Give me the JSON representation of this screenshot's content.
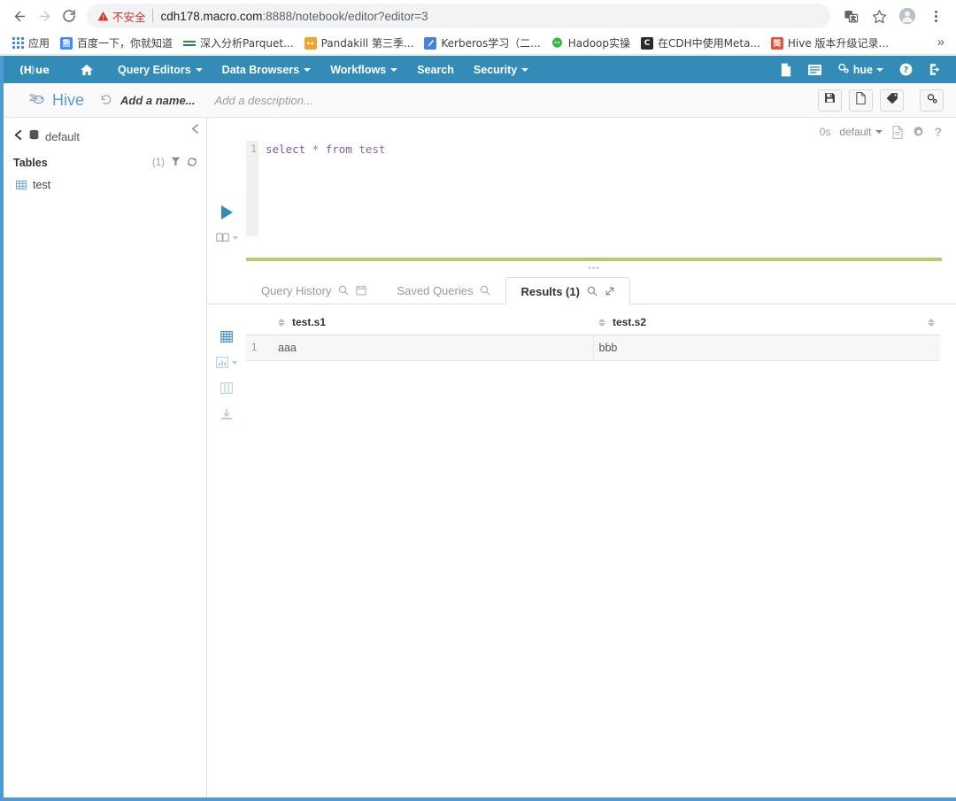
{
  "browser": {
    "back_icon": "back-arrow-icon",
    "forward_icon": "forward-arrow-icon",
    "reload_icon": "reload-icon",
    "security_warning": "不安全",
    "url_host": "cdh178.macro.com",
    "url_rest": ":8888/notebook/editor?editor=3",
    "url_full": "cdh178.macro.com:8888/notebook/editor?editor=3",
    "translate_icon": "translate-icon",
    "bookmark_icon": "star-icon",
    "profile_icon": "profile-avatar-icon",
    "menu_icon": "kebab-menu-icon",
    "bookmarks": [
      {
        "label": "应用",
        "favicon": "apps-grid-icon",
        "color": "#4285f4"
      },
      {
        "label": "百度一下，你就知道",
        "favicon": "baidu-icon",
        "color": "#3b8cff"
      },
      {
        "label": "深入分析Parquet...",
        "favicon": "article-icon",
        "color": "#4c8c3f"
      },
      {
        "label": "Pandakill 第三季...",
        "favicon": "panda-icon",
        "color": "#f0a32e"
      },
      {
        "label": "Kerberos学习（二...",
        "favicon": "pencil-icon",
        "color": "#4a7fe0"
      },
      {
        "label": "Hadoop实操",
        "favicon": "chat-icon",
        "color": "#3ab84a"
      },
      {
        "label": "在CDH中使用Meta...",
        "favicon": "letter-c-icon",
        "color": "#2b2b2b"
      },
      {
        "label": "Hive 版本升级记录...",
        "favicon": "jian-icon",
        "color": "#e8503a"
      }
    ],
    "bookmarks_overflow": "»"
  },
  "hue": {
    "brand": "Hue",
    "home_icon": "home-icon",
    "nav_items": [
      {
        "label": "Query Editors",
        "has_caret": true
      },
      {
        "label": "Data Browsers",
        "has_caret": true
      },
      {
        "label": "Workflows",
        "has_caret": true
      },
      {
        "label": "Search",
        "has_caret": false
      },
      {
        "label": "Security",
        "has_caret": true
      }
    ],
    "nav_right": {
      "documents_icon": "document-icon",
      "jobs_icon": "list-icon",
      "user_label": "hue",
      "user_icon": "gears-icon",
      "help_icon": "help-circle-icon",
      "logout_icon": "logout-icon"
    },
    "navbar_color": "#338bb8"
  },
  "hive_header": {
    "app_icon": "hive-bee-icon",
    "title": "Hive",
    "revert_icon": "revert-history-icon",
    "name_placeholder": "Add a name...",
    "description_placeholder": "Add a description...",
    "actions": [
      {
        "name": "save-button",
        "icon": "floppy-save-icon"
      },
      {
        "name": "new-query-button",
        "icon": "new-document-icon"
      },
      {
        "name": "tag-button",
        "icon": "tag-icon"
      },
      {
        "name": "settings-button",
        "icon": "gears-icon"
      }
    ]
  },
  "assist": {
    "database": "default",
    "back_icon": "chevron-left-icon",
    "db_icon": "database-stack-icon",
    "collapse_icon": "chevron-left-icon",
    "tables_label": "Tables",
    "tables_count": "(1)",
    "filter_icon": "funnel-filter-icon",
    "refresh_icon": "refresh-icon",
    "tables": [
      {
        "label": "test",
        "icon": "table-grid-icon"
      }
    ]
  },
  "editor": {
    "line_number": "1",
    "query_keyword1": "select",
    "query_star": "*",
    "query_keyword2": "from",
    "query_table": "test",
    "query_text": "select * from test",
    "run_icon": "play-run-icon",
    "explain_icon": "book-explain-icon",
    "status_time": "0s",
    "database_selector": "default",
    "doc_icon": "document-icon",
    "gear_icon": "gear-icon",
    "help_icon": "question-mark-icon",
    "progress_color": "#b4cc69",
    "drag_handle": "•••"
  },
  "tabs": [
    {
      "label": "Query History",
      "icons": [
        "search-icon",
        "calendar-icon"
      ],
      "active": false
    },
    {
      "label": "Saved Queries",
      "icons": [
        "search-icon"
      ],
      "active": false
    },
    {
      "label": "Results (1)",
      "icons": [
        "search-icon",
        "expand-icon"
      ],
      "active": true
    }
  ],
  "results": {
    "view_icons": [
      {
        "name": "grid-view-icon",
        "active": true
      },
      {
        "name": "chart-view-icon",
        "active": false,
        "has_caret": true
      },
      {
        "name": "columns-view-icon",
        "active": false
      },
      {
        "name": "download-icon",
        "active": false
      }
    ],
    "columns": [
      "test.s1",
      "test.s2"
    ],
    "rows": [
      {
        "num": "1",
        "cells": [
          "aaa",
          "bbb"
        ]
      }
    ]
  }
}
